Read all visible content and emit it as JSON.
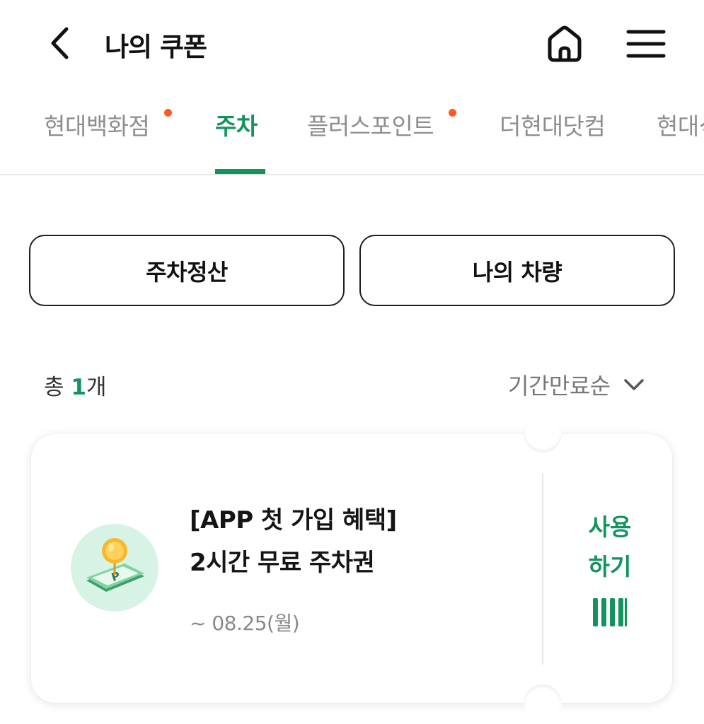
{
  "header": {
    "title": "나의 쿠폰"
  },
  "tabs": [
    {
      "label": "현대백화점",
      "has_dot": true,
      "active": false
    },
    {
      "label": "주차",
      "has_dot": false,
      "active": true
    },
    {
      "label": "플러스포인트",
      "has_dot": true,
      "active": false
    },
    {
      "label": "더현대닷컴",
      "has_dot": false,
      "active": false
    },
    {
      "label": "현대식",
      "has_dot": false,
      "active": false
    }
  ],
  "actions": {
    "parking_payment": "주차정산",
    "my_vehicle": "나의 차량"
  },
  "summary": {
    "prefix": "총 ",
    "count": "1",
    "suffix": "개"
  },
  "sort": {
    "selected": "기간만료순"
  },
  "coupon": {
    "title_line1": "[APP 첫 가입 혜택]",
    "title_line2": "2시간 무료 주차권",
    "expiry": "~ 08.25(월)",
    "use_line1": "사용",
    "use_line2": "하기"
  },
  "colors": {
    "accent": "#14935f",
    "dot": "#ff5a1f",
    "icon_bg": "#d6f3e6"
  },
  "icons": {
    "back": "chevron-left-icon",
    "home": "home-icon",
    "menu": "hamburger-menu-icon",
    "sort": "chevron-down-icon",
    "coupon": "parking-coin-icon",
    "barcode": "barcode-icon"
  }
}
